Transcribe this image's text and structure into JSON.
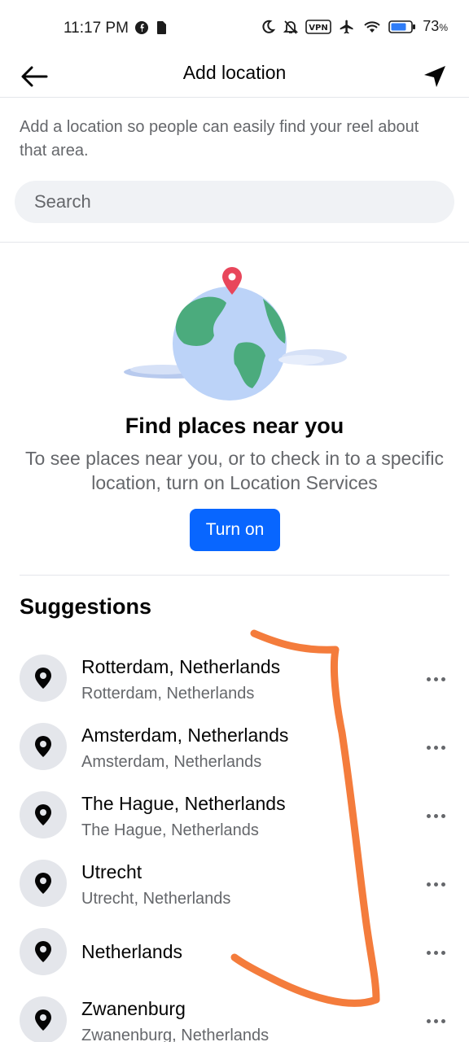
{
  "status_bar": {
    "time": "11:17 PM",
    "battery_percent": "73",
    "battery_unit": "%",
    "vpn_label": "VPN",
    "icons": [
      "facebook-icon",
      "sim-icon",
      "moon-icon",
      "bell-off-icon",
      "vpn-icon",
      "airplane-icon",
      "wifi-icon",
      "battery-icon"
    ]
  },
  "header": {
    "title": "Add location",
    "back_icon": "arrow-left-icon",
    "locate_icon": "navigation-arrow-icon"
  },
  "intro": "Add a location so people can easily find your reel about that area.",
  "search": {
    "placeholder": "Search"
  },
  "location_prompt": {
    "title": "Find places near you",
    "description": "To see places near you, or to check in to a specific location, turn on Location Services",
    "button": "Turn on"
  },
  "suggestions": {
    "heading": "Suggestions",
    "items": [
      {
        "title": "Rotterdam, Netherlands",
        "subtitle": "Rotterdam, Netherlands"
      },
      {
        "title": "Amsterdam, Netherlands",
        "subtitle": "Amsterdam, Netherlands"
      },
      {
        "title": "The Hague, Netherlands",
        "subtitle": "The Hague, Netherlands"
      },
      {
        "title": "Utrecht",
        "subtitle": "Utrecht, Netherlands"
      },
      {
        "title": "Netherlands",
        "subtitle": ""
      },
      {
        "title": "Zwanenburg",
        "subtitle": "Zwanenburg, Netherlands"
      }
    ]
  },
  "colors": {
    "accent": "#0866ff",
    "secondary_text": "#65676b",
    "annotation_stroke": "#f47c3c",
    "pin": "#e8465b"
  }
}
